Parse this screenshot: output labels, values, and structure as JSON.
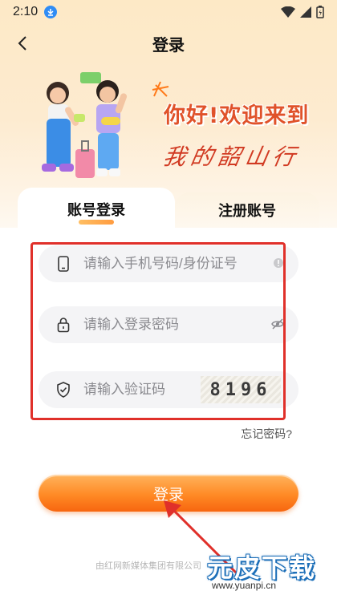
{
  "status_bar": {
    "time": "2:10"
  },
  "nav": {
    "title": "登录"
  },
  "hero": {
    "greeting": "你好!欢迎来到",
    "slogan": "我的韶山行"
  },
  "tabs": [
    {
      "label": "账号登录",
      "active": true
    },
    {
      "label": "注册账号",
      "active": false
    }
  ],
  "form": {
    "phone_placeholder": "请输入手机号码/身份证号",
    "password_placeholder": "请输入登录密码",
    "captcha_placeholder": "请输入验证码",
    "captcha_code": "8196"
  },
  "forgot_password": "忘记密码?",
  "login_button": "登录",
  "footer": "由红网新媒体集团有限公司",
  "watermark": {
    "title": "元皮下载",
    "url": "www.yuanpi.cn"
  },
  "colors": {
    "accent_orange": "#ff8a25",
    "greeting_red": "#e0522a",
    "annotation_red": "#e0302a"
  }
}
